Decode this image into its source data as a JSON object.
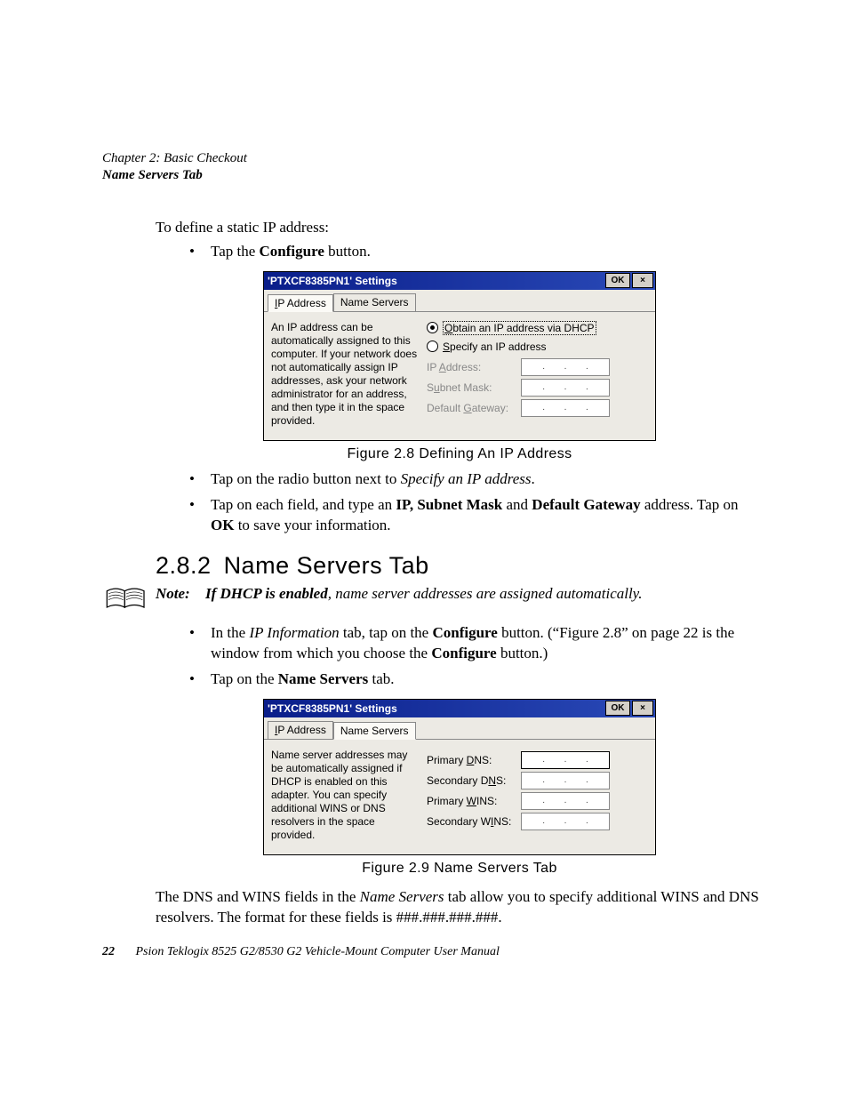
{
  "header": {
    "chapter": "Chapter 2: Basic Checkout",
    "section": "Name Servers Tab"
  },
  "intro": {
    "line1": "To define a static IP address:",
    "bullet1_pre": "Tap the ",
    "bullet1_bold": "Configure",
    "bullet1_post": " button."
  },
  "dialog1": {
    "title": "'PTXCF8385PN1' Settings",
    "ok": "OK",
    "close": "×",
    "tab_ip": "IP Address",
    "tab_ns": "Name Servers",
    "left_text": "An IP address can be automatically assigned to this computer. If your network does not automatically assign IP addresses, ask your network administrator for an address, and then type it in the space provided.",
    "radio_dhcp_pre": "O",
    "radio_dhcp": "btain an IP address via DHCP",
    "radio_specify_pre": "S",
    "radio_specify": "pecify an IP address",
    "lbl_ip_pre": "IP ",
    "lbl_ip_u": "A",
    "lbl_ip_post": "ddress:",
    "lbl_mask_pre": "S",
    "lbl_mask_u": "u",
    "lbl_mask_post": "bnet Mask:",
    "lbl_gw_pre": "Default ",
    "lbl_gw_u": "G",
    "lbl_gw_post": "ateway:"
  },
  "fig1_caption": "Figure 2.8 Defining An IP Address",
  "after_fig1": {
    "b1_pre": "Tap on the radio button next to ",
    "b1_it": "Specify an IP address",
    "b1_post": ".",
    "b2_pre": "Tap on each field, and type an ",
    "b2_bold1": "IP, Subnet Mask",
    "b2_mid": " and ",
    "b2_bold2": "Default Gateway",
    "b2_line2_pre": "address. Tap on ",
    "b2_bold3": "OK",
    "b2_line2_post": " to save your information."
  },
  "section_heading": {
    "num": "2.8.2",
    "title": "Name Servers Tab"
  },
  "note": {
    "label": "Note:",
    "bold": "If DHCP is enabled",
    "rest": ", name server addresses are assigned automatically."
  },
  "after_note": {
    "b1_pre": "In the ",
    "b1_it": "IP Information",
    "b1_mid": " tab, tap on the ",
    "b1_bold": "Configure",
    "b1_post1": " button. (“Figure 2.8” on page 22 is the window from which you choose the ",
    "b1_bold2": "Configure",
    "b1_post2": " button.)",
    "b2_pre": "Tap on the ",
    "b2_bold": "Name Servers",
    "b2_post": " tab."
  },
  "dialog2": {
    "title": "'PTXCF8385PN1' Settings",
    "ok": "OK",
    "close": "×",
    "tab_ip": "IP Address",
    "tab_ns": "Name Servers",
    "left_text": "Name server addresses may be automatically assigned if DHCP is enabled on this adapter. You can specify additional WINS or DNS resolvers in the space provided.",
    "lbl_pdns_pre": "Primary ",
    "lbl_pdns_u": "D",
    "lbl_pdns_post": "NS:",
    "lbl_sdns_pre": "Secondary D",
    "lbl_sdns_u": "N",
    "lbl_sdns_post": "S:",
    "lbl_pwins_pre": "Primary ",
    "lbl_pwins_u": "W",
    "lbl_pwins_post": "INS:",
    "lbl_swins_pre": "Secondary W",
    "lbl_swins_u": "I",
    "lbl_swins_post": "NS:"
  },
  "fig2_caption": "Figure 2.9 Name Servers Tab",
  "closing_para_pre": "The DNS and WINS fields in the ",
  "closing_para_it": "Name Servers",
  "closing_para_post": " tab allow you to specify additional WINS and DNS resolvers. The format for these fields is ###.###.###.###.",
  "footer": {
    "page": "22",
    "text": "Psion Teklogix 8525 G2/8530 G2 Vehicle-Mount Computer User Manual"
  }
}
